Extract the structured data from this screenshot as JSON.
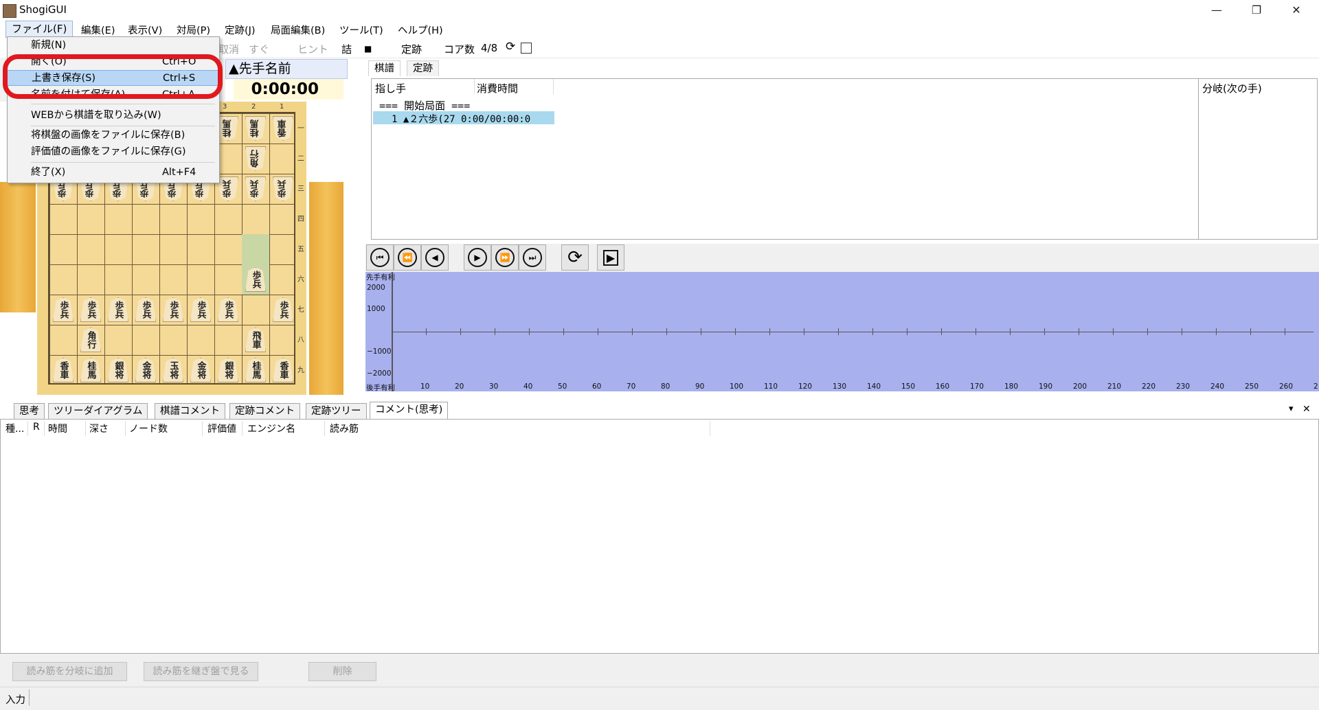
{
  "window": {
    "title": "ShogiGUI",
    "minimize": "—",
    "restore": "❐",
    "close": "✕"
  },
  "menubar": [
    {
      "label": "ファイル(F)"
    },
    {
      "label": "編集(E)"
    },
    {
      "label": "表示(V)"
    },
    {
      "label": "対局(P)"
    },
    {
      "label": "定跡(J)"
    },
    {
      "label": "局面編集(B)"
    },
    {
      "label": "ツール(T)"
    },
    {
      "label": "ヘルプ(H)"
    }
  ],
  "toolbar": {
    "undo": "取消",
    "now": "すぐ",
    "hint": "ヒント",
    "mate": "詰",
    "stop": "■",
    "joseki": "定跡",
    "cores_label": "コア数",
    "cores_value": "4/8"
  },
  "player": {
    "name": "▲先手名前",
    "clock": "0:00:00"
  },
  "file_menu": {
    "items": [
      {
        "label": "新規(N)",
        "shortcut": ""
      },
      {
        "label": "開く(O)",
        "shortcut": "Ctrl+O"
      },
      {
        "label": "上書き保存(S)",
        "shortcut": "Ctrl+S"
      },
      {
        "label": "名前を付けて保存(A)...",
        "shortcut": "Ctrl+A"
      },
      {
        "label": "WEBから棋譜を取り込み(W)",
        "shortcut": ""
      },
      {
        "label": "将棋盤の画像をファイルに保存(B)",
        "shortcut": ""
      },
      {
        "label": "評価値の画像をファイルに保存(G)",
        "shortcut": ""
      },
      {
        "label": "終了(X)",
        "shortcut": "Alt+F4"
      }
    ]
  },
  "board": {
    "files": [
      "3",
      "2",
      "1"
    ],
    "ranks": [
      "一",
      "二",
      "三",
      "四",
      "五",
      "六",
      "七",
      "八",
      "九"
    ],
    "pieces": {
      "pawn": "歩兵",
      "knight": "桂馬",
      "silver": "銀将",
      "gold": "金将",
      "king": "玉将",
      "lance": "香車",
      "rook": "飛車",
      "bishop": "角行"
    }
  },
  "kifu": {
    "tabs": [
      "棋譜",
      "定跡"
    ],
    "col_move": "指し手",
    "col_time": "消費時間",
    "start": "=== 開始局面 ===",
    "move1": "1 ▲２六歩(27 0:00/00:00:0",
    "branch_header": "分岐(次の手)"
  },
  "nav": {
    "first": "⏮",
    "back10": "⏪",
    "back": "◀",
    "fwd": "▶",
    "fwd10": "⏩",
    "last": "⏭",
    "loop": "⟳",
    "play": "▶"
  },
  "graph": {
    "top_label": "先手有利",
    "bottom_label": "後手有利",
    "y_ticks": [
      "2000",
      "1000",
      "−1000",
      "−2000"
    ],
    "x_ticks": [
      "10",
      "20",
      "30",
      "40",
      "50",
      "60",
      "70",
      "80",
      "90",
      "100",
      "110",
      "120",
      "130",
      "140",
      "150",
      "160",
      "170",
      "180",
      "190",
      "200",
      "210",
      "220",
      "230",
      "240",
      "250",
      "260",
      "2"
    ]
  },
  "bottom_tabs": [
    "思考",
    "ツリーダイアグラム",
    "棋譜コメント",
    "定跡コメント",
    "定跡ツリー",
    "コメント(思考)"
  ],
  "bottom_tab_ctrl": {
    "dropdown": "▾",
    "close": "✕"
  },
  "think_columns": [
    "種...",
    "R",
    "時間",
    "深さ",
    "ノード数",
    "評価値",
    "エンジン名",
    "読み筋"
  ],
  "think_buttons": [
    "読み筋を分岐に追加",
    "読み筋を継ぎ盤で見る",
    "削除"
  ],
  "status": {
    "text": "入力"
  },
  "colors": {
    "highlight_ring": "#e0191f",
    "menu_highlight": "#b9d7f5",
    "graph_bg": "#a8b0ee",
    "selected_move": "#a9d9ee"
  }
}
